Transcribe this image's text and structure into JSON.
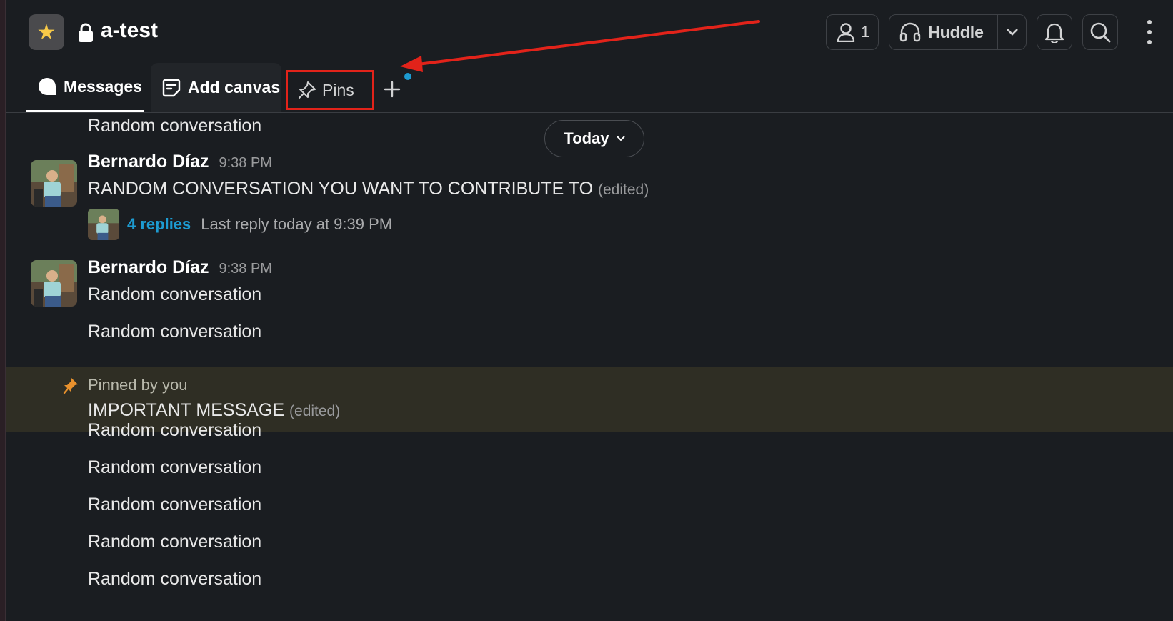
{
  "header": {
    "channel_name": "a-test",
    "channel_icon": "star",
    "members_count": "1",
    "huddle_label": "Huddle"
  },
  "tabs": {
    "messages": "Messages",
    "canvas": "Add canvas",
    "pins": "Pins"
  },
  "date_pill": "Today",
  "messages": {
    "m0": "Random conversation",
    "author1": "Bernardo Díaz",
    "time1": "9:38 PM",
    "m1": "RANDOM CONVERSATION YOU WANT TO CONTRIBUTE TO",
    "m1_edited": "(edited)",
    "replies_count": "4 replies",
    "replies_meta": "Last reply today at 9:39 PM",
    "author2": "Bernardo Díaz",
    "time2": "9:38 PM",
    "m2": "Random conversation",
    "m3": "Random conversation",
    "pinned_by": "Pinned by you",
    "pinned_text": "IMPORTANT MESSAGE",
    "pinned_edited": "(edited)",
    "m4": "Random conversation",
    "m5": "Random conversation",
    "m6": "Random conversation",
    "m7": "Random conversation",
    "m8": "Random conversation"
  },
  "colors": {
    "accent_link": "#1d9bd1",
    "highlight_box": "#e2231a",
    "pinned_bg": "#2f2e24"
  }
}
